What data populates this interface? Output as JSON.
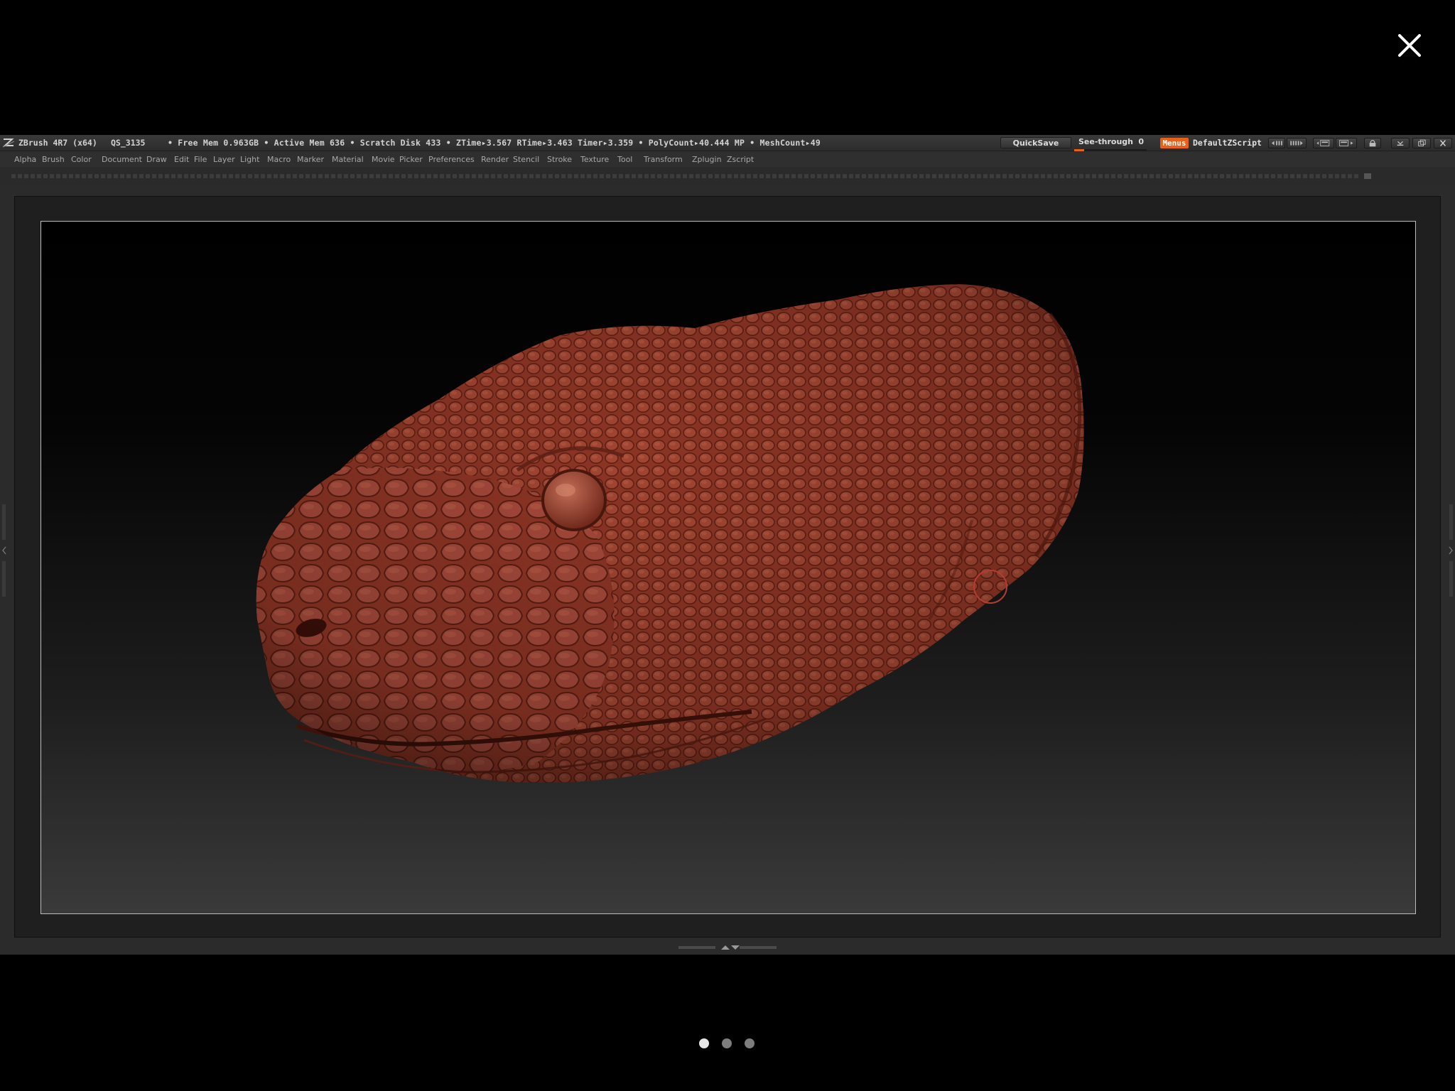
{
  "viewer": {
    "close_icon": "close-icon",
    "pager": {
      "page_count": 3,
      "current_page": 1
    }
  },
  "titlebar": {
    "app_title": "ZBrush 4R7 (x64)",
    "file_name": "QS_3135",
    "stats": "• Free Mem 0.963GB • Active Mem 636 • Scratch Disk 433 •  ZTime▸3.567 RTime▸3.463 Timer▸3.359 • PolyCount▸40.444 MP  • MeshCount▸49",
    "quicksave_label": "QuickSave",
    "seethrough_label": "See-through",
    "seethrough_value": "0",
    "menus_label": "Menus",
    "zscript_label": "DefaultZScript",
    "accent_color": "#e8601a"
  },
  "menubar": {
    "items": [
      "Alpha",
      "Brush",
      "Color",
      "Document",
      "Draw",
      "Edit",
      "File",
      "Layer",
      "Light",
      "Macro",
      "Marker",
      "Material",
      "Movie",
      "Picker",
      "Preferences",
      "Render",
      "Stencil",
      "Stroke",
      "Texture",
      "Tool",
      "Transform",
      "Zplugin",
      "Zscript"
    ]
  },
  "canvas": {
    "model_color": "#8b3424",
    "brush_cursor_color": "#b43c30"
  }
}
